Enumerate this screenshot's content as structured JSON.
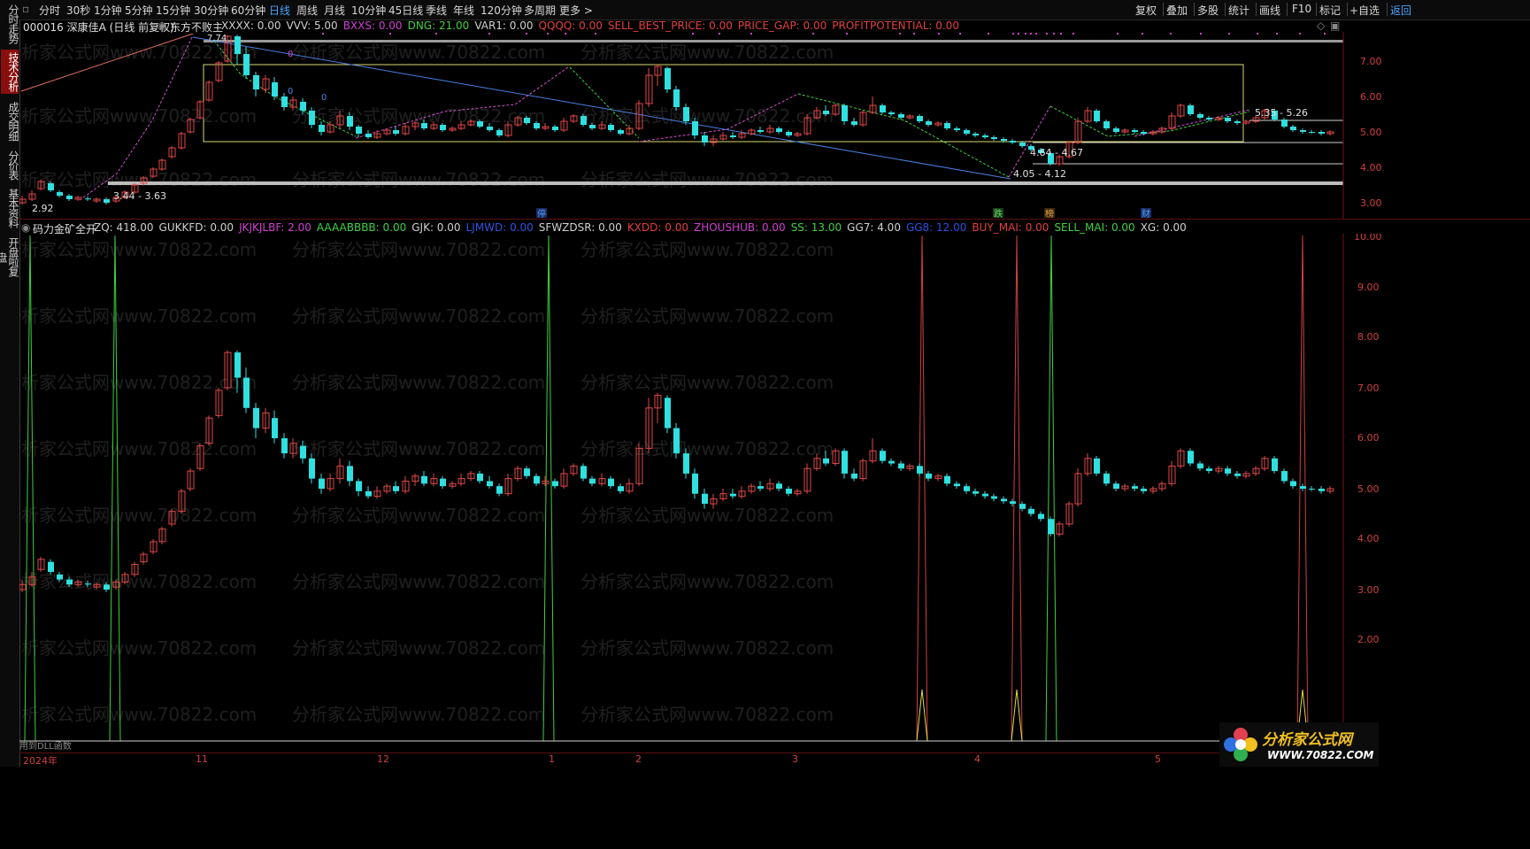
{
  "left_tabs": [
    {
      "label": "分时走势",
      "active": false
    },
    {
      "label": "技术分析",
      "active": true
    },
    {
      "label": "成交明细",
      "active": false
    },
    {
      "label": "分价表",
      "active": false
    },
    {
      "label": "基本资料",
      "active": false
    },
    {
      "label": "开盘啦复盘",
      "active": false
    }
  ],
  "toolbar": {
    "periods": [
      "分时",
      "30秒",
      "1分钟",
      "5分钟",
      "15分钟",
      "30分钟",
      "60分钟",
      "日线",
      "周线",
      "月线",
      "10分钟",
      "45日线",
      "季线",
      "年线",
      "120分钟",
      "多周期",
      "更多 >"
    ],
    "active_period": "日线",
    "right_items": [
      "复权",
      "叠加",
      "多股",
      "统计",
      "画线",
      "F10",
      "标记",
      "+自选",
      "返回"
    ]
  },
  "main": {
    "stock_title": "000016 深康佳A (日线 前复权)",
    "indicator_name": "东方不败主",
    "params": [
      {
        "label": "XXXX: 0.00",
        "color": "#d0d0d0"
      },
      {
        "label": "VVV: 5.00",
        "color": "#d0d0d0"
      },
      {
        "label": "BXXS: 0.00",
        "color": "#d040d0"
      },
      {
        "label": "DNG: 21.00",
        "color": "#40d040"
      },
      {
        "label": "VAR1: 0.00",
        "color": "#d0d0d0"
      },
      {
        "label": "QQQQ: 0.00",
        "color": "#e04040"
      },
      {
        "label": "SELL_BEST_PRICE: 0.00",
        "color": "#e04040"
      },
      {
        "label": "PRICE_GAP: 0.00",
        "color": "#e04040"
      },
      {
        "label": "PROFITPOTENTIAL: 0.00",
        "color": "#e04040"
      }
    ],
    "price_axis": [
      "7.00",
      "6.00",
      "5.00",
      "4.00",
      "3.00"
    ],
    "annotations": [
      {
        "text": "3.44 - 3.63"
      },
      {
        "text": "2.92"
      },
      {
        "text": "5.35 - 5.26"
      },
      {
        "text": "4.64 - 4.67"
      },
      {
        "text": "4.05 - 4.12"
      },
      {
        "text": "0"
      },
      {
        "text": "0"
      },
      {
        "text": "0"
      },
      {
        "text": "7.74"
      }
    ],
    "event_badges": [
      "停",
      "跌",
      "榜",
      "财"
    ]
  },
  "sub": {
    "indicator_name": "码力金矿全开",
    "params": [
      {
        "label": "ZQ: 418.00",
        "color": "#d0d0d0"
      },
      {
        "label": "GUKKFD: 0.00",
        "color": "#d0d0d0"
      },
      {
        "label": "JKJKJLBF: 2.00",
        "color": "#d040d0"
      },
      {
        "label": "AAAABBBB: 0.00",
        "color": "#40d040"
      },
      {
        "label": "GJK: 0.00",
        "color": "#d0d0d0"
      },
      {
        "label": "LJMWD: 0.00",
        "color": "#3050e0"
      },
      {
        "label": "SFWZDSR: 0.00",
        "color": "#d0d0d0"
      },
      {
        "label": "KXDD: 0.00",
        "color": "#e04040"
      },
      {
        "label": "ZHOUSHUB: 0.00",
        "color": "#d040d0"
      },
      {
        "label": "SS: 13.00",
        "color": "#40d040"
      },
      {
        "label": "GG7: 4.00",
        "color": "#d0d0d0"
      },
      {
        "label": "GG8: 12.00",
        "color": "#3050e0"
      },
      {
        "label": "BUY_MAI: 0.00",
        "color": "#e04040"
      },
      {
        "label": "SELL_MAI: 0.00",
        "color": "#40d040"
      },
      {
        "label": "XG: 0.00",
        "color": "#d0d0d0"
      }
    ],
    "price_axis": [
      "10.00",
      "9.00",
      "8.00",
      "7.00",
      "6.00",
      "5.00",
      "4.00",
      "3.00",
      "2.00"
    ],
    "footer_note": "用到DLL函数"
  },
  "time_axis": [
    "2024年",
    "11",
    "12",
    "1",
    "2",
    "3",
    "4",
    "5"
  ],
  "watermark": "分析家公式网www.70822.com",
  "logo": {
    "title": "分析家公式网",
    "url": "WWW.70822.COM"
  },
  "colors": {
    "up": "#e04848",
    "down": "#2fe0e0",
    "active_tab": "#8a0e0e",
    "accent": "#4aa3ff"
  }
}
